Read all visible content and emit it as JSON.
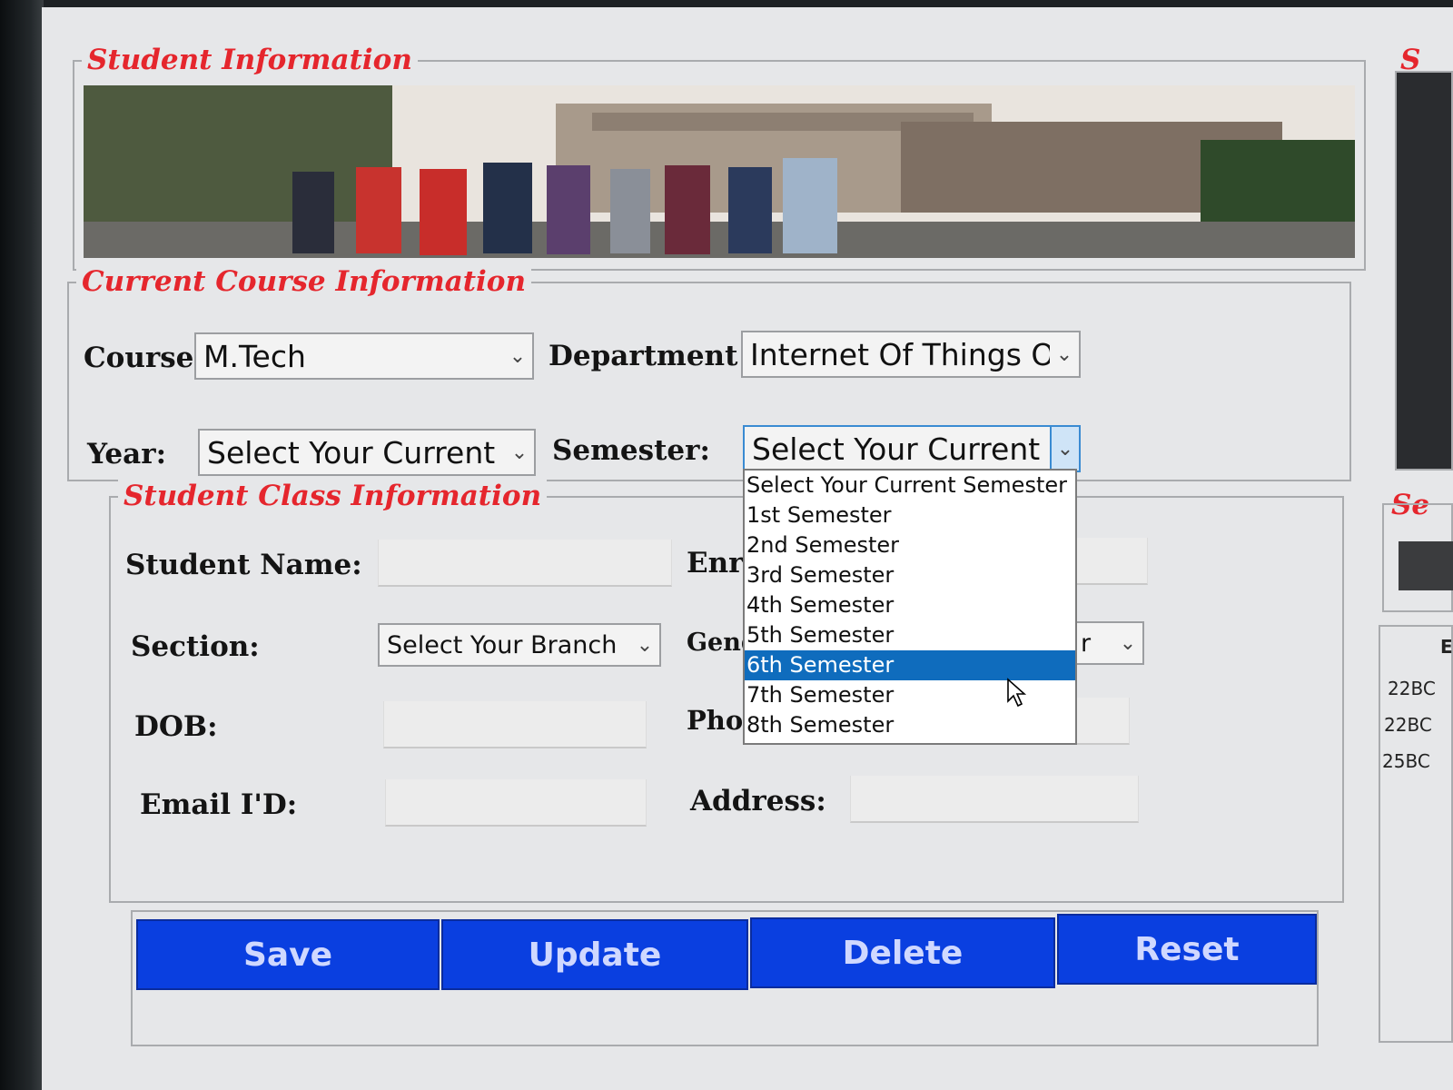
{
  "student_info": {
    "legend": "Student Information"
  },
  "course_info": {
    "legend": "Current Course Information",
    "course_label": "Course",
    "course_value": "M.Tech",
    "department_label": "Department",
    "department_value": "Internet Of Things O",
    "year_label": "Year:",
    "year_value": "Select Your Current",
    "semester_label": "Semester:",
    "semester_value": "Select Your Current"
  },
  "semester_dropdown": {
    "options": [
      "Select Your Current Semester",
      "1st Semester",
      "2nd Semester",
      "3rd Semester",
      "4th Semester",
      "5th Semester",
      "6th Semester",
      "7th Semester",
      "8th Semester"
    ],
    "highlighted": "6th Semester"
  },
  "class_info": {
    "legend": "Student Class Information",
    "student_name_label": "Student Name:",
    "enrollment_label_partial": "Enr",
    "section_label": "Section:",
    "section_value": "Select Your Branch",
    "gender_label_partial": "Gend",
    "gender_value_partial": "r",
    "dob_label": "DOB:",
    "phone_label_partial": "Phor",
    "email_label": "Email I'D:",
    "address_label": "Address:"
  },
  "buttons": {
    "save": "Save",
    "update": "Update",
    "delete": "Delete",
    "reset": "Reset"
  },
  "right_panel": {
    "legend_partial_top": "S",
    "legend_partial_mid": "Se",
    "column_partial": "E",
    "rows_partial": [
      "22BC",
      "22BC",
      "25BC"
    ]
  },
  "colors": {
    "legend_red": "#e5262d",
    "button_blue": "#0a3fe0",
    "selection_blue": "#0f6cbd"
  }
}
